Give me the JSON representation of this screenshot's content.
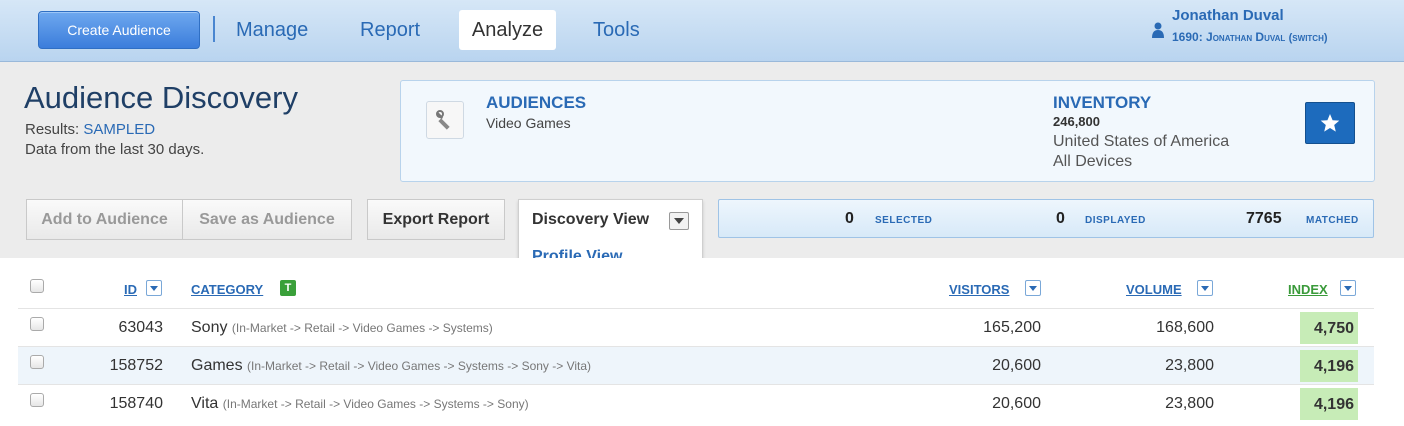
{
  "nav": {
    "create_label": "Create Audience",
    "items": [
      {
        "label": "Manage"
      },
      {
        "label": "Report"
      },
      {
        "label": "Analyze"
      },
      {
        "label": "Tools"
      }
    ],
    "user_name": "Jonathan Duval",
    "account": "1690: Jonathan Duval",
    "switch_label": "(switch)"
  },
  "header": {
    "title": "Audience Discovery",
    "results_label": "Results:",
    "results_value": "SAMPLED",
    "data_from": "Data from the last 30 days."
  },
  "info": {
    "audiences_heading": "AUDIENCES",
    "audiences_value": "Video Games",
    "inventory_heading": "INVENTORY",
    "inventory_count": "246,800",
    "inventory_country": "United States of America",
    "inventory_devices": "All Devices"
  },
  "toolbar": {
    "add_label": "Add to Audience",
    "save_label": "Save as Audience",
    "export_label": "Export Report",
    "view_selected": "Discovery View",
    "view_option": "Profile View"
  },
  "status": {
    "selected_count": "0",
    "selected_label": "SELECTED",
    "displayed_count": "0",
    "displayed_label": "DISPLAYED",
    "matched_count": "7765",
    "matched_label": "MATCHED"
  },
  "table": {
    "headers": {
      "id": "ID",
      "category": "CATEGORY",
      "visitors": "VISITORS",
      "volume": "VOLUME",
      "index": "INDEX"
    },
    "rows": [
      {
        "id": "63043",
        "name": "Sony",
        "path": "(In-Market -> Retail -> Video Games -> Systems)",
        "visitors": "165,200",
        "volume": "168,600",
        "index": "4,750"
      },
      {
        "id": "158752",
        "name": "Games",
        "path": "(In-Market -> Retail -> Video Games -> Systems -> Sony -> Vita)",
        "visitors": "20,600",
        "volume": "23,800",
        "index": "4,196"
      },
      {
        "id": "158740",
        "name": "Vita",
        "path": "(In-Market -> Retail -> Video Games -> Systems -> Sony)",
        "visitors": "20,600",
        "volume": "23,800",
        "index": "4,196"
      }
    ]
  }
}
